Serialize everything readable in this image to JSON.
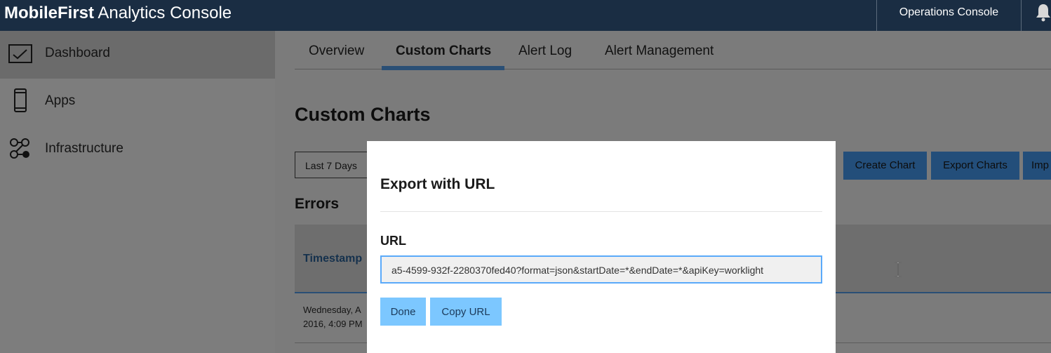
{
  "app": {
    "brand_bold": "MobileFirst",
    "brand_rest": " Analytics Console"
  },
  "header": {
    "operations_console": "Operations Console",
    "notification_icon": "bell-icon"
  },
  "sidebar": {
    "items": [
      {
        "label": "Dashboard",
        "icon": "dashboard-icon",
        "active": true
      },
      {
        "label": "Apps",
        "icon": "mobile-device-icon",
        "active": false
      },
      {
        "label": "Infrastructure",
        "icon": "infrastructure-icon",
        "active": false
      }
    ]
  },
  "tabs": [
    {
      "label": "Overview",
      "active": false
    },
    {
      "label": "Custom Charts",
      "active": true
    },
    {
      "label": "Alert Log",
      "active": false
    },
    {
      "label": "Alert Management",
      "active": false
    }
  ],
  "main": {
    "title": "Custom Charts",
    "date_range": "Last 7 Days",
    "actions": [
      {
        "label": "Create Chart"
      },
      {
        "label": "Export Charts"
      },
      {
        "label": "Imp"
      }
    ],
    "section_title": "Errors",
    "table": {
      "headers": [
        "Timestamp"
      ],
      "rows": [
        {
          "timestamp_line1": "Wednesday, A",
          "timestamp_line2": "2016, 4:09 PM"
        }
      ]
    }
  },
  "modal": {
    "title": "Export with URL",
    "field_label": "URL",
    "url_value": "a5-4599-932f-2280370fed40?format=json&startDate=*&endDate=*&apiKey=worklight",
    "done_label": "Done",
    "copy_label": "Copy URL"
  },
  "colors": {
    "topbar": "#1a2d43",
    "accent": "#5aaafa",
    "modal_button": "#7cc7ff"
  }
}
